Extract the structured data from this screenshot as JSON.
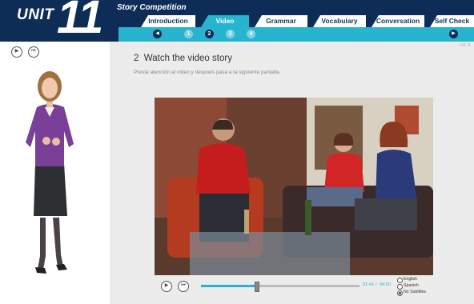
{
  "header": {
    "unit_label": "UNIT",
    "unit_number": "11",
    "section_title": "Story Competition",
    "tabs": [
      {
        "label": "Introduction",
        "active": false
      },
      {
        "label": "Video",
        "active": true
      },
      {
        "label": "Grammar",
        "active": false
      },
      {
        "label": "Vocabulary",
        "active": false
      },
      {
        "label": "Conversation",
        "active": false
      },
      {
        "label": "Self Check",
        "active": false
      }
    ],
    "steps": [
      "1",
      "2",
      "3",
      "4"
    ],
    "current_step": "2"
  },
  "left_panel": {
    "play_icon": "play-icon",
    "restart_icon": "restart-icon"
  },
  "content": {
    "version": "v10.11",
    "heading_number": "2",
    "heading": "Watch the video story",
    "instruction": "Presta atención al vídeo y después pasa a la siguiente pantalla."
  },
  "player": {
    "time_current": "01:42",
    "time_separator": "/",
    "time_total": "04:50",
    "progress": 0.35,
    "subtitle_options": [
      {
        "label": "English",
        "selected": false
      },
      {
        "label": "Spanish",
        "selected": false
      },
      {
        "label": "No Subtitles",
        "selected": true
      }
    ]
  },
  "colors": {
    "navy": "#0d2d57",
    "accent": "#27b4cf",
    "content_bg": "#ececec"
  }
}
